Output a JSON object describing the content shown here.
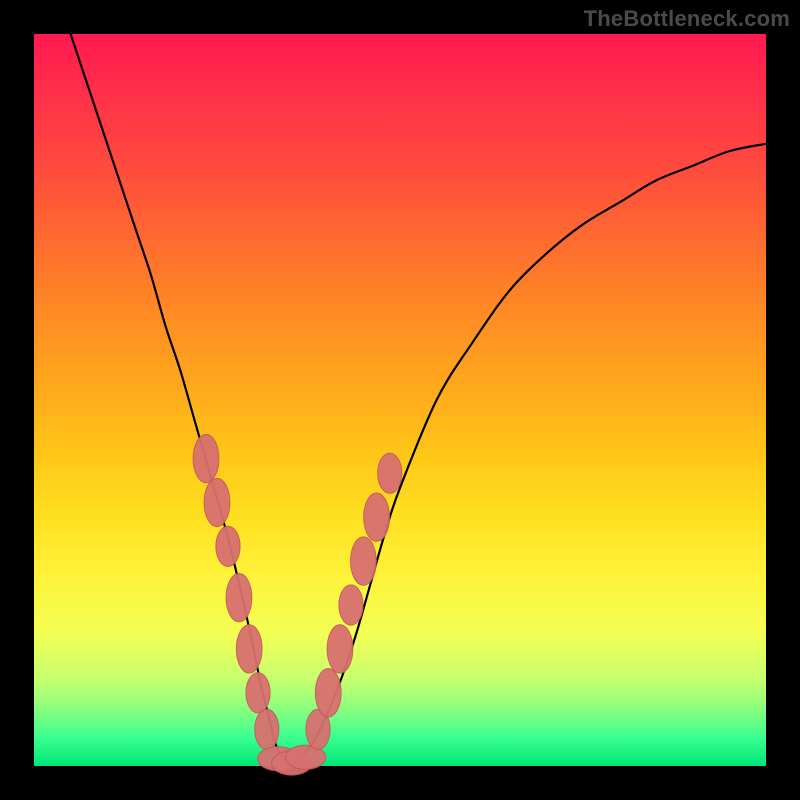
{
  "watermark": "TheBottleneck.com",
  "colors": {
    "background": "#000000",
    "gradient_top": "#ff1a4f",
    "gradient_bottom": "#00e878",
    "curve": "#000000",
    "marker_fill": "#d87070",
    "marker_stroke": "#c45a5a"
  },
  "chart_data": {
    "type": "line",
    "title": "",
    "xlabel": "",
    "ylabel": "",
    "xlim": [
      0,
      100
    ],
    "ylim": [
      0,
      100
    ],
    "grid": false,
    "legend": false,
    "series": [
      {
        "name": "bottleneck-curve",
        "x": [
          5,
          6,
          8,
          10,
          12,
          14,
          16,
          18,
          20,
          22,
          24,
          26,
          28,
          30,
          31,
          32,
          33,
          34,
          35,
          36,
          38,
          40,
          42,
          44,
          46,
          48,
          50,
          55,
          60,
          65,
          70,
          75,
          80,
          85,
          90,
          95,
          100
        ],
        "y": [
          100,
          97,
          91,
          85,
          79,
          73,
          67,
          60,
          54,
          47,
          40,
          33,
          25,
          16,
          11,
          7,
          3,
          1,
          0,
          1,
          3,
          7,
          12,
          18,
          25,
          32,
          38,
          50,
          58,
          65,
          70,
          74,
          77,
          80,
          82,
          84,
          85
        ]
      }
    ],
    "markers_left": [
      {
        "x": 23.5,
        "y": 42,
        "rx": 3.2,
        "ry": 6
      },
      {
        "x": 25.0,
        "y": 36,
        "rx": 3.2,
        "ry": 6
      },
      {
        "x": 26.5,
        "y": 30,
        "rx": 3.0,
        "ry": 5
      },
      {
        "x": 28.0,
        "y": 23,
        "rx": 3.2,
        "ry": 6
      },
      {
        "x": 29.4,
        "y": 16,
        "rx": 3.2,
        "ry": 6
      },
      {
        "x": 30.6,
        "y": 10,
        "rx": 3.0,
        "ry": 5
      },
      {
        "x": 31.8,
        "y": 5,
        "rx": 3.0,
        "ry": 5
      }
    ],
    "markers_bottom": [
      {
        "x": 33.3,
        "y": 1.0,
        "rx": 5,
        "ry": 3
      },
      {
        "x": 35.2,
        "y": 0.4,
        "rx": 5,
        "ry": 3
      },
      {
        "x": 37.1,
        "y": 1.2,
        "rx": 5,
        "ry": 3
      }
    ],
    "markers_right": [
      {
        "x": 38.8,
        "y": 5,
        "rx": 3.0,
        "ry": 5
      },
      {
        "x": 40.2,
        "y": 10,
        "rx": 3.2,
        "ry": 6
      },
      {
        "x": 41.8,
        "y": 16,
        "rx": 3.2,
        "ry": 6
      },
      {
        "x": 43.3,
        "y": 22,
        "rx": 3.0,
        "ry": 5
      },
      {
        "x": 45.0,
        "y": 28,
        "rx": 3.2,
        "ry": 6
      },
      {
        "x": 46.8,
        "y": 34,
        "rx": 3.2,
        "ry": 6
      },
      {
        "x": 48.6,
        "y": 40,
        "rx": 3.0,
        "ry": 5
      }
    ]
  }
}
